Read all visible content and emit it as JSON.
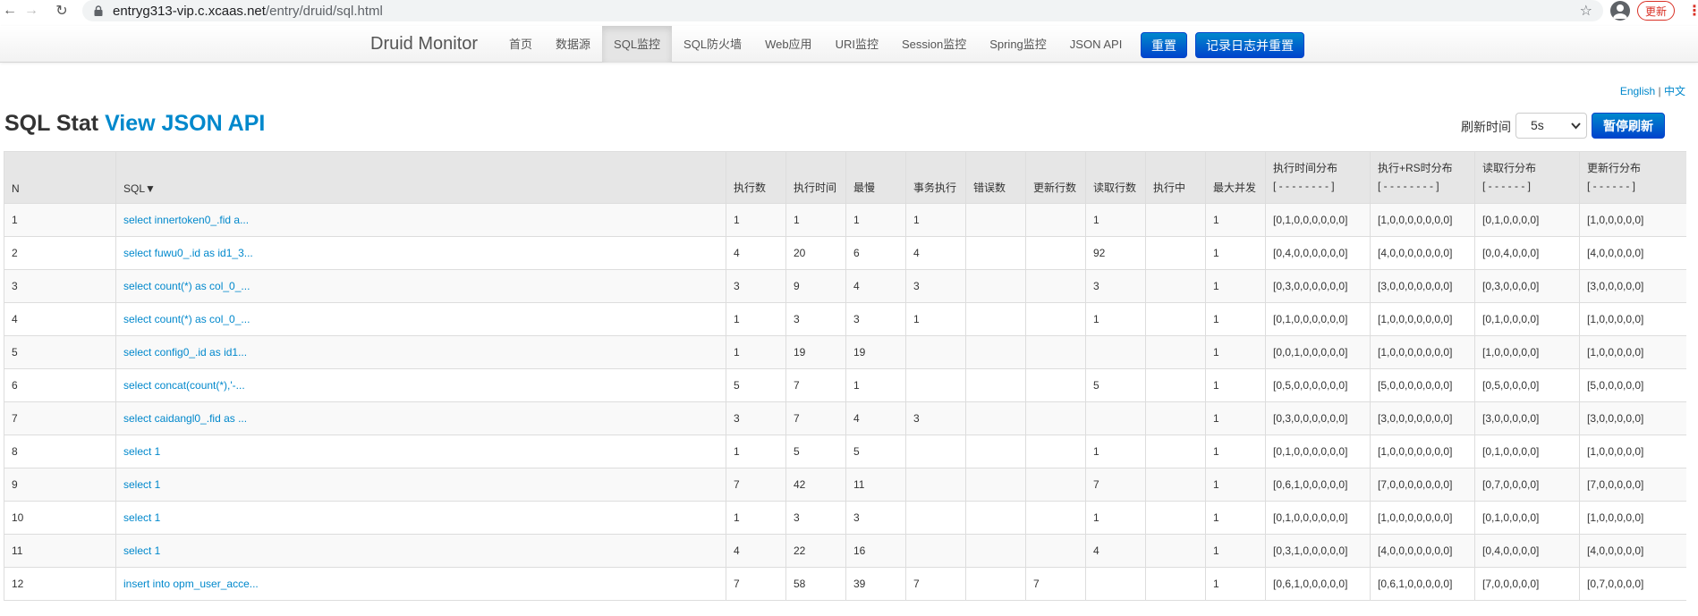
{
  "browser": {
    "back_icon": "←",
    "forward_icon": "→",
    "reload_icon": "↻",
    "url_host": "entryg313-vip.c.xcaas.net",
    "url_path": "/entry/druid/sql.html",
    "star_icon": "☆",
    "update_label": "更新",
    "more_icon": "⋮"
  },
  "navbar": {
    "brand": "Druid Monitor",
    "items": [
      "首页",
      "数据源",
      "SQL监控",
      "SQL防火墙",
      "Web应用",
      "URI监控",
      "Session监控",
      "Spring监控",
      "JSON API"
    ],
    "active_index": 2,
    "reset_label": "重置",
    "log_reset_label": "记录日志并重置"
  },
  "lang": {
    "english": "English",
    "separator": "|",
    "chinese": "中文"
  },
  "heading": {
    "title": "SQL Stat",
    "link": "View JSON API"
  },
  "refresh": {
    "label": "刷新时间",
    "value": "5s",
    "pause_label": "暂停刷新"
  },
  "table": {
    "headers": {
      "n": "N",
      "sql": "SQL▼",
      "exec_count": "执行数",
      "exec_time": "执行时间",
      "slowest": "最慢",
      "txn_exec": "事务执行",
      "error_count": "错误数",
      "update_rows": "更新行数",
      "fetch_rows": "读取行数",
      "running": "执行中",
      "max_concurrent": "最大并发",
      "exec_hist": "执行时间分布",
      "exec_rs_hist": "执行+RS时分布",
      "fetch_hist": "读取行分布",
      "update_hist": "更新行分布",
      "hist8": "[ - - - - - - - - ]",
      "hist6": "[ - - - - - - ]"
    },
    "rows": [
      {
        "n": "1",
        "sql": "select innertoken0_.fid a...",
        "exec_count": "1",
        "exec_time": "1",
        "slowest": "1",
        "txn": "1",
        "errors": "",
        "updates": "",
        "fetch": "1",
        "running": "",
        "max_conc": "1",
        "exec_hist": "[0,1,0,0,0,0,0,0]",
        "rs_hist": "[1,0,0,0,0,0,0,0]",
        "fetch_hist": "[0,1,0,0,0,0]",
        "update_hist": "[1,0,0,0,0,0]"
      },
      {
        "n": "2",
        "sql": "select fuwu0_.id as id1_3...",
        "exec_count": "4",
        "exec_time": "20",
        "slowest": "6",
        "txn": "4",
        "errors": "",
        "updates": "",
        "fetch": "92",
        "running": "",
        "max_conc": "1",
        "exec_hist": "[0,4,0,0,0,0,0,0]",
        "rs_hist": "[4,0,0,0,0,0,0,0]",
        "fetch_hist": "[0,0,4,0,0,0]",
        "update_hist": "[4,0,0,0,0,0]"
      },
      {
        "n": "3",
        "sql": "select count(*) as col_0_...",
        "exec_count": "3",
        "exec_time": "9",
        "slowest": "4",
        "txn": "3",
        "errors": "",
        "updates": "",
        "fetch": "3",
        "running": "",
        "max_conc": "1",
        "exec_hist": "[0,3,0,0,0,0,0,0]",
        "rs_hist": "[3,0,0,0,0,0,0,0]",
        "fetch_hist": "[0,3,0,0,0,0]",
        "update_hist": "[3,0,0,0,0,0]"
      },
      {
        "n": "4",
        "sql": "select count(*) as col_0_...",
        "exec_count": "1",
        "exec_time": "3",
        "slowest": "3",
        "txn": "1",
        "errors": "",
        "updates": "",
        "fetch": "1",
        "running": "",
        "max_conc": "1",
        "exec_hist": "[0,1,0,0,0,0,0,0]",
        "rs_hist": "[1,0,0,0,0,0,0,0]",
        "fetch_hist": "[0,1,0,0,0,0]",
        "update_hist": "[1,0,0,0,0,0]"
      },
      {
        "n": "5",
        "sql": "select config0_.id as id1...",
        "exec_count": "1",
        "exec_time": "19",
        "slowest": "19",
        "txn": "",
        "errors": "",
        "updates": "",
        "fetch": "",
        "running": "",
        "max_conc": "1",
        "exec_hist": "[0,0,1,0,0,0,0,0]",
        "rs_hist": "[1,0,0,0,0,0,0,0]",
        "fetch_hist": "[1,0,0,0,0,0]",
        "update_hist": "[1,0,0,0,0,0]"
      },
      {
        "n": "6",
        "sql": "select concat(count(*),'-...",
        "exec_count": "5",
        "exec_time": "7",
        "slowest": "1",
        "txn": "",
        "errors": "",
        "updates": "",
        "fetch": "5",
        "running": "",
        "max_conc": "1",
        "exec_hist": "[0,5,0,0,0,0,0,0]",
        "rs_hist": "[5,0,0,0,0,0,0,0]",
        "fetch_hist": "[0,5,0,0,0,0]",
        "update_hist": "[5,0,0,0,0,0]"
      },
      {
        "n": "7",
        "sql": "select caidangl0_.fid as ...",
        "exec_count": "3",
        "exec_time": "7",
        "slowest": "4",
        "txn": "3",
        "errors": "",
        "updates": "",
        "fetch": "",
        "running": "",
        "max_conc": "1",
        "exec_hist": "[0,3,0,0,0,0,0,0]",
        "rs_hist": "[3,0,0,0,0,0,0,0]",
        "fetch_hist": "[3,0,0,0,0,0]",
        "update_hist": "[3,0,0,0,0,0]"
      },
      {
        "n": "8",
        "sql": "select 1",
        "exec_count": "1",
        "exec_time": "5",
        "slowest": "5",
        "txn": "",
        "errors": "",
        "updates": "",
        "fetch": "1",
        "running": "",
        "max_conc": "1",
        "exec_hist": "[0,1,0,0,0,0,0,0]",
        "rs_hist": "[1,0,0,0,0,0,0,0]",
        "fetch_hist": "[0,1,0,0,0,0]",
        "update_hist": "[1,0,0,0,0,0]"
      },
      {
        "n": "9",
        "sql": "select 1",
        "exec_count": "7",
        "exec_time": "42",
        "slowest": "11",
        "txn": "",
        "errors": "",
        "updates": "",
        "fetch": "7",
        "running": "",
        "max_conc": "1",
        "exec_hist": "[0,6,1,0,0,0,0,0]",
        "rs_hist": "[7,0,0,0,0,0,0,0]",
        "fetch_hist": "[0,7,0,0,0,0]",
        "update_hist": "[7,0,0,0,0,0]"
      },
      {
        "n": "10",
        "sql": "select 1",
        "exec_count": "1",
        "exec_time": "3",
        "slowest": "3",
        "txn": "",
        "errors": "",
        "updates": "",
        "fetch": "1",
        "running": "",
        "max_conc": "1",
        "exec_hist": "[0,1,0,0,0,0,0,0]",
        "rs_hist": "[1,0,0,0,0,0,0,0]",
        "fetch_hist": "[0,1,0,0,0,0]",
        "update_hist": "[1,0,0,0,0,0]"
      },
      {
        "n": "11",
        "sql": "select 1",
        "exec_count": "4",
        "exec_time": "22",
        "slowest": "16",
        "txn": "",
        "errors": "",
        "updates": "",
        "fetch": "4",
        "running": "",
        "max_conc": "1",
        "exec_hist": "[0,3,1,0,0,0,0,0]",
        "rs_hist": "[4,0,0,0,0,0,0,0]",
        "fetch_hist": "[0,4,0,0,0,0]",
        "update_hist": "[4,0,0,0,0,0]"
      },
      {
        "n": "12",
        "sql": "insert into opm_user_acce...",
        "exec_count": "7",
        "exec_time": "58",
        "slowest": "39",
        "txn": "7",
        "errors": "",
        "updates": "7",
        "fetch": "",
        "running": "",
        "max_conc": "1",
        "exec_hist": "[0,6,1,0,0,0,0,0]",
        "rs_hist": "[0,6,1,0,0,0,0,0]",
        "fetch_hist": "[7,0,0,0,0,0]",
        "update_hist": "[0,7,0,0,0,0]"
      }
    ]
  }
}
